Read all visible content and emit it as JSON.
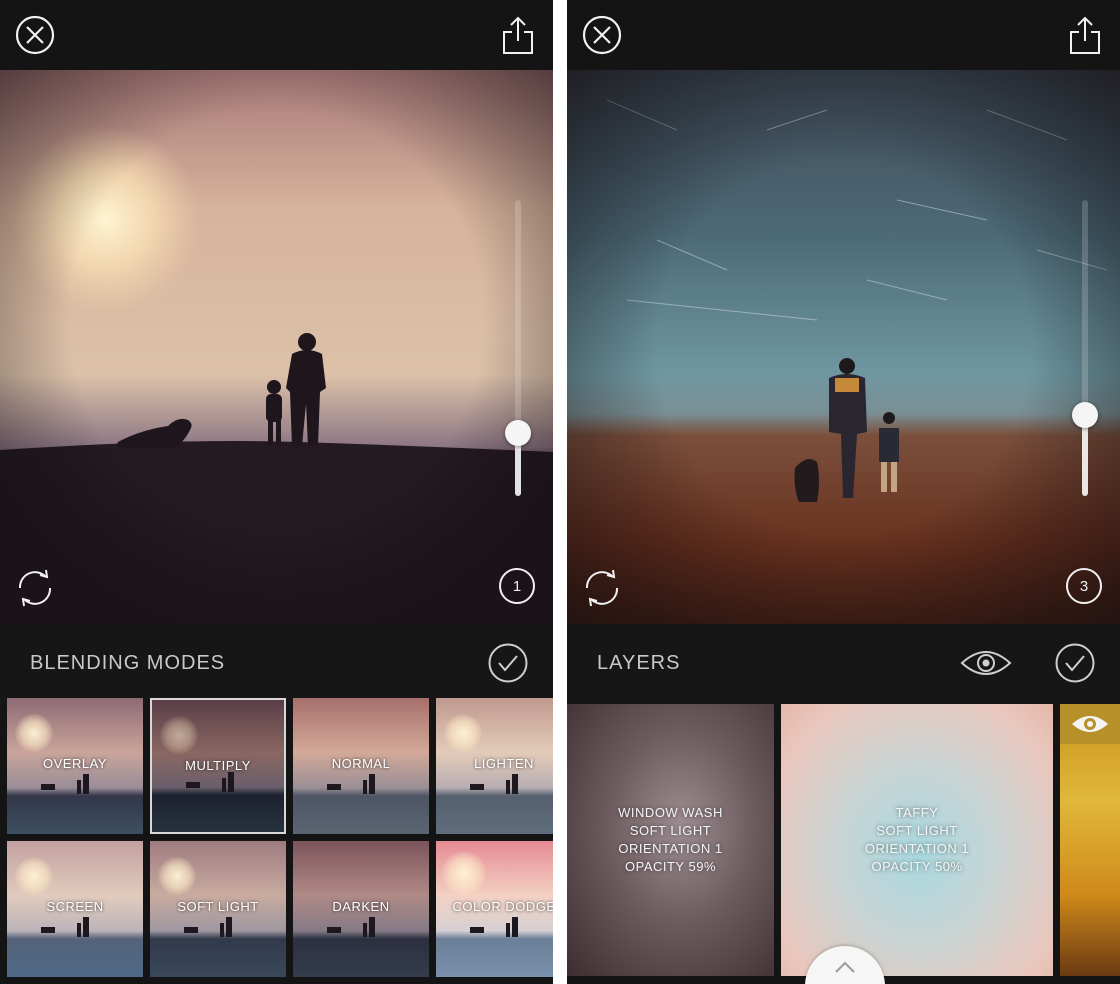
{
  "left": {
    "panel_title": "BLENDING MODES",
    "layer_count": "1",
    "opacity_level": 0.21,
    "blend_modes": [
      {
        "label": "OVERLAY",
        "selected": false
      },
      {
        "label": "MULTIPLY",
        "selected": true
      },
      {
        "label": "NORMAL",
        "selected": false
      },
      {
        "label": "LIGHTEN",
        "selected": false
      },
      {
        "label": "SCREEN",
        "selected": false
      },
      {
        "label": "SOFT LIGHT",
        "selected": false
      },
      {
        "label": "DARKEN",
        "selected": false
      },
      {
        "label": "COLOR DODGE",
        "selected": false
      }
    ]
  },
  "right": {
    "panel_title": "LAYERS",
    "layer_count": "3",
    "opacity_level": 0.28,
    "layers": [
      {
        "name": "WINDOW WASH",
        "blend": "SOFT LIGHT",
        "orientation": "ORIENTATION 1",
        "opacity": "OPACITY 59%"
      },
      {
        "name": "TAFFY",
        "blend": "SOFT LIGHT",
        "orientation": "ORIENTATION 1",
        "opacity": "OPACITY 50%"
      }
    ]
  },
  "icons": {
    "close": "close-circle-icon",
    "share": "share-icon",
    "sync": "sync-arrows-icon",
    "confirm": "checkmark-circle-icon",
    "visibility": "eye-icon",
    "expand": "chevron-up-icon"
  },
  "colors": {
    "background": "#141414",
    "text": "#c9c9c9",
    "selection": "#d8d8d8"
  }
}
